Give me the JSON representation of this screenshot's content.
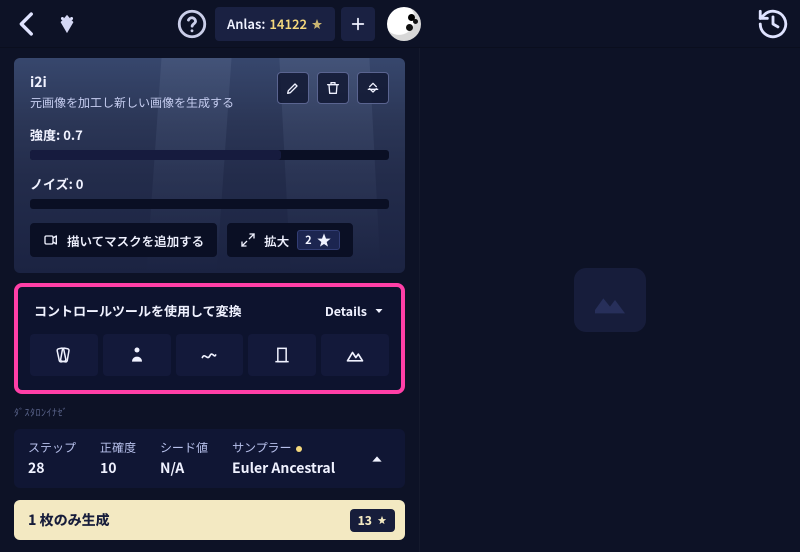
{
  "topbar": {
    "anlas_label": "Anlas:",
    "anlas_value": "14122"
  },
  "i2i": {
    "title": "i2i",
    "subtitle": "元画像を加工し新しい画像を生成する",
    "strength_label": "強度:",
    "strength_value": "0.7",
    "strength_fill_pct": 70,
    "noise_label": "ノイズ:",
    "noise_value": "0",
    "noise_fill_pct": 0,
    "mask_button": "描いてマスクを追加する",
    "enlarge_label": "拡大",
    "enlarge_cost": "2"
  },
  "control": {
    "title": "コントロールツールを使用して変換",
    "details_label": "Details"
  },
  "hint_text": "ﾀﾞｽﾀﾛﾝｲﾅｾﾞ",
  "params": {
    "steps_label": "ステップ",
    "steps_value": "28",
    "accuracy_label": "正確度",
    "accuracy_value": "10",
    "seed_label": "シード値",
    "seed_value": "N/A",
    "sampler_label": "サンプラー",
    "sampler_value": "Euler Ancestral"
  },
  "generate": {
    "label": "1 枚のみ生成",
    "cost": "13"
  }
}
